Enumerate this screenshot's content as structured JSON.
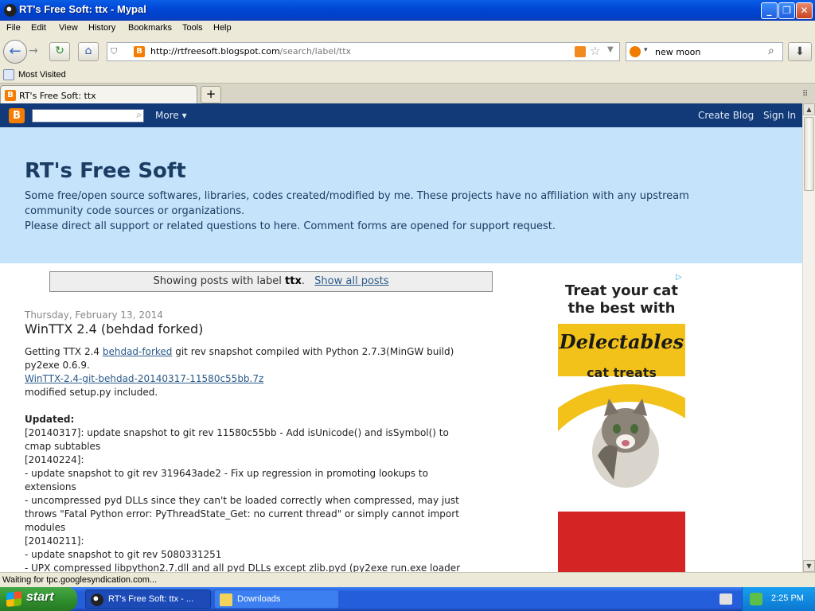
{
  "window": {
    "title": "RT's Free Soft: ttx - Mypal"
  },
  "menu": [
    "File",
    "Edit",
    "View",
    "History",
    "Bookmarks",
    "Tools",
    "Help"
  ],
  "nav": {
    "url_host": "http://rtfreesoft.blogspot.com",
    "url_path": "/search/label/ttx",
    "search_value": "new moon"
  },
  "bookmarks": {
    "most_visited": "Most Visited"
  },
  "tabs": [
    {
      "label": "RT's Free Soft: ttx"
    }
  ],
  "blog_nav": {
    "more": "More ▾",
    "create": "Create Blog",
    "signin": "Sign In"
  },
  "header": {
    "title": "RT's Free Soft",
    "line1": "Some free/open source softwares, libraries, codes created/modified by me. These projects have no affiliation with any upstream",
    "line2": "community code sources or organizations.",
    "line3": "Please direct all support or related questions to here. Comment forms are opened for support request."
  },
  "status_box": {
    "prefix": "Showing posts with label ",
    "label": "ttx",
    "suffix": ".",
    "link": "Show all posts"
  },
  "post": {
    "date": "Thursday, February 13, 2014",
    "title": "WinTTX 2.4 (behdad forked)",
    "intro_a": "Getting TTX 2.4 ",
    "intro_link": "behdad-forked",
    "intro_b": " git rev snapshot compiled with Python 2.7.3(MinGW build)",
    "intro_c": "py2exe 0.6.9.",
    "download_link": "WinTTX-2.4-git-behdad-20140317-11580c55bb.7z",
    "setup": "modified setup.py included.",
    "updated": "Updated:",
    "lines": [
      "[20140317]: update snapshot to git rev 11580c55bb - Add isUnicode() and isSymbol() to",
      "cmap subtables",
      "[20140224]:",
      "- update snapshot to git rev 319643ade2 - Fix up regression in promoting lookups to",
      "extensions",
      "- uncompressed pyd DLLs since they can't be loaded correctly when compressed, may just",
      "throws \"Fatal Python error: PyThreadState_Get: no current thread\" or simply cannot import",
      "modules",
      "[20140211]:",
      "- update snapshot to git rev 5080331251",
      "- UPX compressed libpython2.7.dll and all pyd DLLs except zlib.pyd (py2exe run.exe loader"
    ]
  },
  "ad": {
    "headline1": "Treat your cat",
    "headline2": "the best with",
    "brand": "Delectables",
    "tagline": "cat treats"
  },
  "statusbar": {
    "text": "Waiting for tpc.googlesyndication.com..."
  },
  "taskbar": {
    "start": "start",
    "tasks": [
      {
        "label": "RT's Free Soft: ttx - ..."
      },
      {
        "label": "Downloads"
      }
    ],
    "clock": "2:25 PM"
  }
}
